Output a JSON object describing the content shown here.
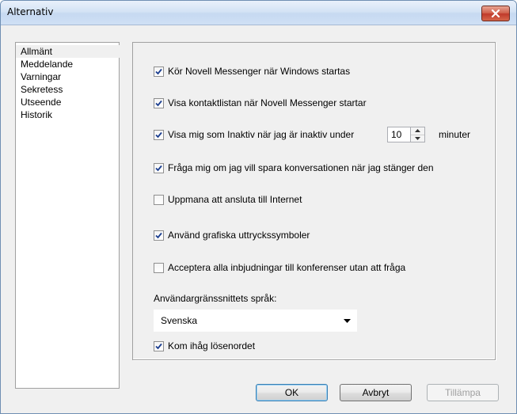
{
  "window": {
    "title": "Alternativ"
  },
  "categories": [
    {
      "label": "Allmänt",
      "selected": true
    },
    {
      "label": "Meddelande",
      "selected": false
    },
    {
      "label": "Varningar",
      "selected": false
    },
    {
      "label": "Sekretess",
      "selected": false
    },
    {
      "label": "Utseende",
      "selected": false
    },
    {
      "label": "Historik",
      "selected": false
    }
  ],
  "options": [
    {
      "label": "Kör Novell Messenger när Windows startas",
      "checked": true
    },
    {
      "label": "Visa kontaktlistan när Novell Messenger startar",
      "checked": true
    },
    {
      "label": "Visa mig som Inaktiv när jag är inaktiv under",
      "checked": true
    },
    {
      "label": "Fråga mig om jag vill spara konversationen när jag stänger den",
      "checked": true
    },
    {
      "label": "Uppmana att ansluta till Internet",
      "checked": false
    },
    {
      "label": "Använd grafiska uttryckssymboler",
      "checked": true
    },
    {
      "label": "Acceptera alla inbjudningar till konferenser utan att fråga",
      "checked": false
    }
  ],
  "inactivity": {
    "value": "10",
    "unit": "minuter"
  },
  "language": {
    "label": "Användargränssnittets språk:",
    "selected": "Svenska"
  },
  "remember_password": {
    "label": "Kom ihåg lösenordet",
    "checked": true
  },
  "buttons": {
    "ok": "OK",
    "cancel": "Avbryt",
    "apply": "Tillämpa"
  },
  "colors": {
    "check_mark": "#1a3d8f",
    "close_button": "#c0392b"
  }
}
